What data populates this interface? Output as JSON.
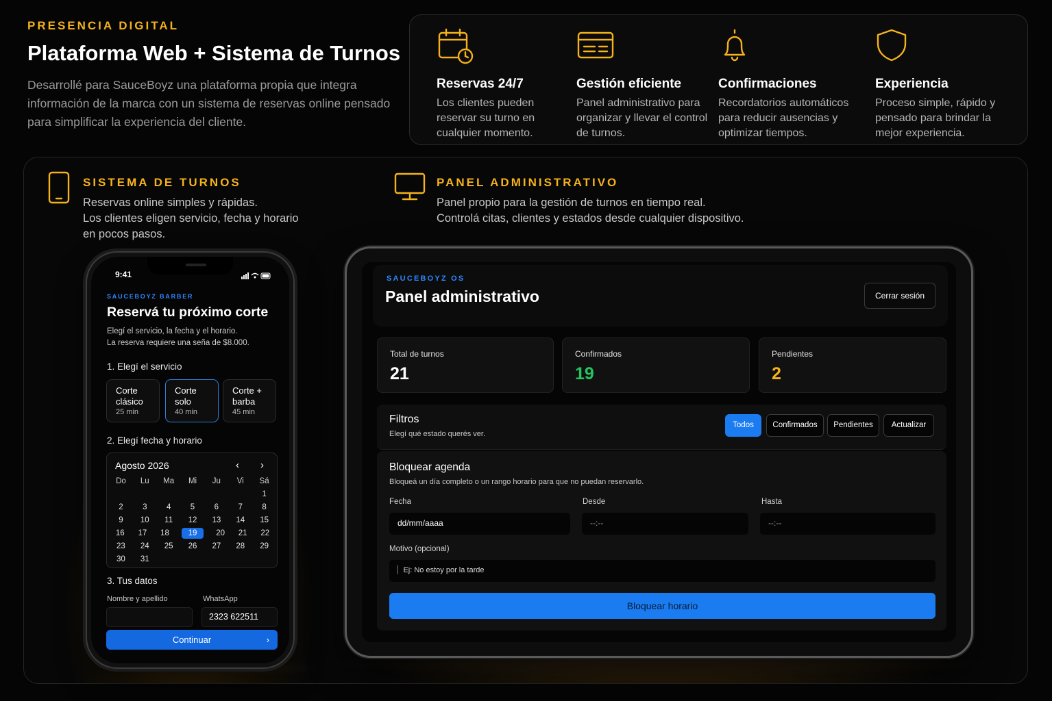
{
  "header": {
    "eyebrow": "PRESENCIA DIGITAL",
    "title": "Plataforma Web + Sistema de Turnos",
    "intro": "Desarrollé para SauceBoyz una plataforma propia que integra información de la marca con un sistema de reservas online pensado para simplificar la experiencia del cliente."
  },
  "features": [
    {
      "icon": "calendar-clock-icon",
      "title": "Reservas 24/7",
      "desc": "Los clientes pueden reservar su turno en cualquier momento."
    },
    {
      "icon": "card-icon",
      "title": "Gestión eficiente",
      "desc": "Panel administrativo para organizar y llevar el control de turnos."
    },
    {
      "icon": "bell-icon",
      "title": "Confirmaciones",
      "desc": "Recordatorios automáticos para reducir ausencias y optimizar tiempos."
    },
    {
      "icon": "shield-icon",
      "title": "Experiencia",
      "desc": "Proceso simple, rápido y pensado para brindar la mejor experiencia."
    }
  ],
  "sections": {
    "turnos": {
      "title": "SISTEMA DE TURNOS",
      "lines": [
        "Reservas online simples y rápidas.",
        "Los clientes eligen servicio, fecha y horario",
        "en pocos pasos."
      ]
    },
    "panel": {
      "title": "PANEL ADMINISTRATIVO",
      "lines": [
        "Panel propio para la gestión de turnos en tiempo real.",
        "Controlá citas, clientes y estados desde cualquier dispositivo."
      ]
    }
  },
  "phone": {
    "time": "9:41",
    "brand": "SAUCEBOYZ BARBER",
    "title": "Reservá tu próximo corte",
    "sub1": "Elegí el servicio, la fecha y el horario.",
    "sub2": "La reserva requiere una seña de $8.000.",
    "step1": "1. Elegí el servicio",
    "services": [
      {
        "l1": "Corte",
        "l2": "clásico",
        "time": "25 min",
        "selected": false
      },
      {
        "l1": "Corte",
        "l2": "solo",
        "time": "40 min",
        "selected": true
      },
      {
        "l1": "Corte +",
        "l2": "barba",
        "time": "45 min",
        "selected": false
      }
    ],
    "step2": "2. Elegí fecha y horario",
    "calendar": {
      "month": "Agosto 2026",
      "weekdays": [
        "Do",
        "Lu",
        "Ma",
        "Mi",
        "Ju",
        "Vi",
        "Sá"
      ],
      "weeks": [
        [
          "",
          "",
          "",
          "",
          "",
          "",
          "1"
        ],
        [
          "2",
          "3",
          "4",
          "5",
          "6",
          "7",
          "8"
        ],
        [
          "9",
          "10",
          "11",
          "12",
          "13",
          "14",
          "15"
        ],
        [
          "16",
          "17",
          "18",
          "19",
          "20",
          "21",
          "22"
        ],
        [
          "23",
          "24",
          "25",
          "26",
          "27",
          "28",
          "29"
        ],
        [
          "30",
          "31",
          "",
          "",
          "",
          "",
          ""
        ]
      ],
      "selected": "19"
    },
    "step3": "3. Tus datos",
    "name_label": "Nombre y apellido",
    "name_value": "",
    "whatsapp_label": "WhatsApp",
    "whatsapp_value": "2323 622511",
    "continue": "Continuar"
  },
  "tablet": {
    "brand": "SAUCEBOYZ OS",
    "title": "Panel administrativo",
    "logout": "Cerrar sesión",
    "stats": [
      {
        "label": "Total de turnos",
        "value": "21",
        "color": "#ffffff"
      },
      {
        "label": "Confirmados",
        "value": "19",
        "color": "#22c55e"
      },
      {
        "label": "Pendientes",
        "value": "2",
        "color": "#f5b21b"
      }
    ],
    "filters": {
      "title": "Filtros",
      "sub": "Elegí qué estado querés ver.",
      "buttons": [
        "Todos",
        "Confirmados",
        "Pendientes",
        "Actualizar"
      ],
      "active": "Todos"
    },
    "block": {
      "title": "Bloquear agenda",
      "sub": "Bloqueá un día completo o un rango horario para que no puedan reservarlo.",
      "fecha_label": "Fecha",
      "fecha_value": "dd/mm/aaaa",
      "desde_label": "Desde",
      "desde_value": "--:--",
      "hasta_label": "Hasta",
      "hasta_value": "--:--",
      "motivo_label": "Motivo (opcional)",
      "motivo_placeholder": "Ej: No estoy por la tarde",
      "button": "Bloquear horario"
    }
  },
  "colors": {
    "accent": "#f5b21b",
    "blue": "#1a7cf0",
    "green": "#22c55e"
  }
}
